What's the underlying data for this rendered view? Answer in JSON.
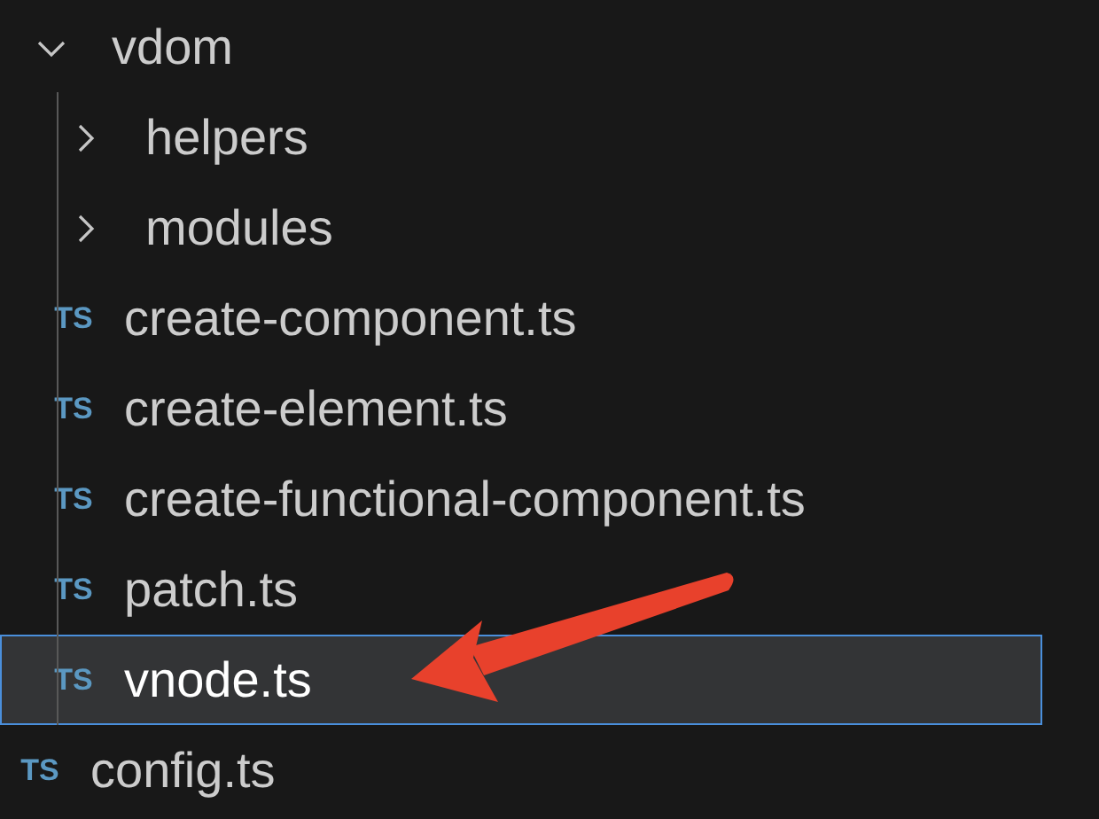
{
  "tree": [
    {
      "name": "vdom",
      "kind": "folder",
      "expanded": true,
      "selected": false,
      "children": [
        {
          "name": "helpers",
          "kind": "folder",
          "expanded": false,
          "selected": false
        },
        {
          "name": "modules",
          "kind": "folder",
          "expanded": false,
          "selected": false
        },
        {
          "name": "create-component.ts",
          "kind": "file",
          "badge": "TS",
          "selected": false
        },
        {
          "name": "create-element.ts",
          "kind": "file",
          "badge": "TS",
          "selected": false
        },
        {
          "name": "create-functional-component.ts",
          "kind": "file",
          "badge": "TS",
          "selected": false
        },
        {
          "name": "patch.ts",
          "kind": "file",
          "badge": "TS",
          "selected": false
        },
        {
          "name": "vnode.ts",
          "kind": "file",
          "badge": "TS",
          "selected": true
        }
      ]
    },
    {
      "name": "config.ts",
      "kind": "file",
      "badge": "TS",
      "selected": false
    }
  ]
}
